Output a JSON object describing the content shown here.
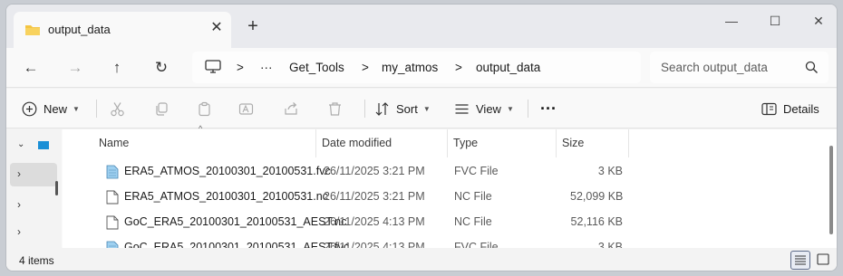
{
  "tab": {
    "title": "output_data"
  },
  "window_controls": {
    "minimize": "—",
    "maximize": "☐",
    "close": "✕",
    "new_tab": "+",
    "tab_close": "✕"
  },
  "nav": {
    "back": "←",
    "forward": "→",
    "up": "↑",
    "refresh": "↻"
  },
  "breadcrumb": {
    "separator": ">",
    "overflow": "···",
    "items": [
      "Get_Tools",
      "my_atmos",
      "output_data"
    ]
  },
  "search": {
    "placeholder": "Search output_data"
  },
  "commands": {
    "new": "New",
    "sort": "Sort",
    "view": "View",
    "more": "···",
    "details": "Details"
  },
  "columns": {
    "name": "Name",
    "date": "Date modified",
    "type": "Type",
    "size": "Size",
    "sort_caret": "^"
  },
  "files": [
    {
      "name": "ERA5_ATMOS_20100301_20100531.fvc",
      "date": "26/11/2025 3:21 PM",
      "type": "FVC File",
      "size": "3 KB",
      "icon": "fvc-file-icon"
    },
    {
      "name": "ERA5_ATMOS_20100301_20100531.nc",
      "date": "26/11/2025 3:21 PM",
      "type": "NC File",
      "size": "52,099 KB",
      "icon": "nc-file-icon"
    },
    {
      "name": "GoC_ERA5_20100301_20100531_AEST.nc",
      "date": "26/11/2025 4:13 PM",
      "type": "NC File",
      "size": "52,116 KB",
      "icon": "nc-file-icon"
    },
    {
      "name": "GoC_ERA5_20100301_20100531_AEST.fvc",
      "date": "26/11/2025 4:13 PM",
      "type": "FVC File",
      "size": "3 KB",
      "icon": "fvc-file-icon"
    }
  ],
  "status": {
    "items": "4 items"
  },
  "colors": {
    "accent": "#0067c0",
    "folder": "#f4c542",
    "fvc_icon": "#7fb9e0"
  }
}
